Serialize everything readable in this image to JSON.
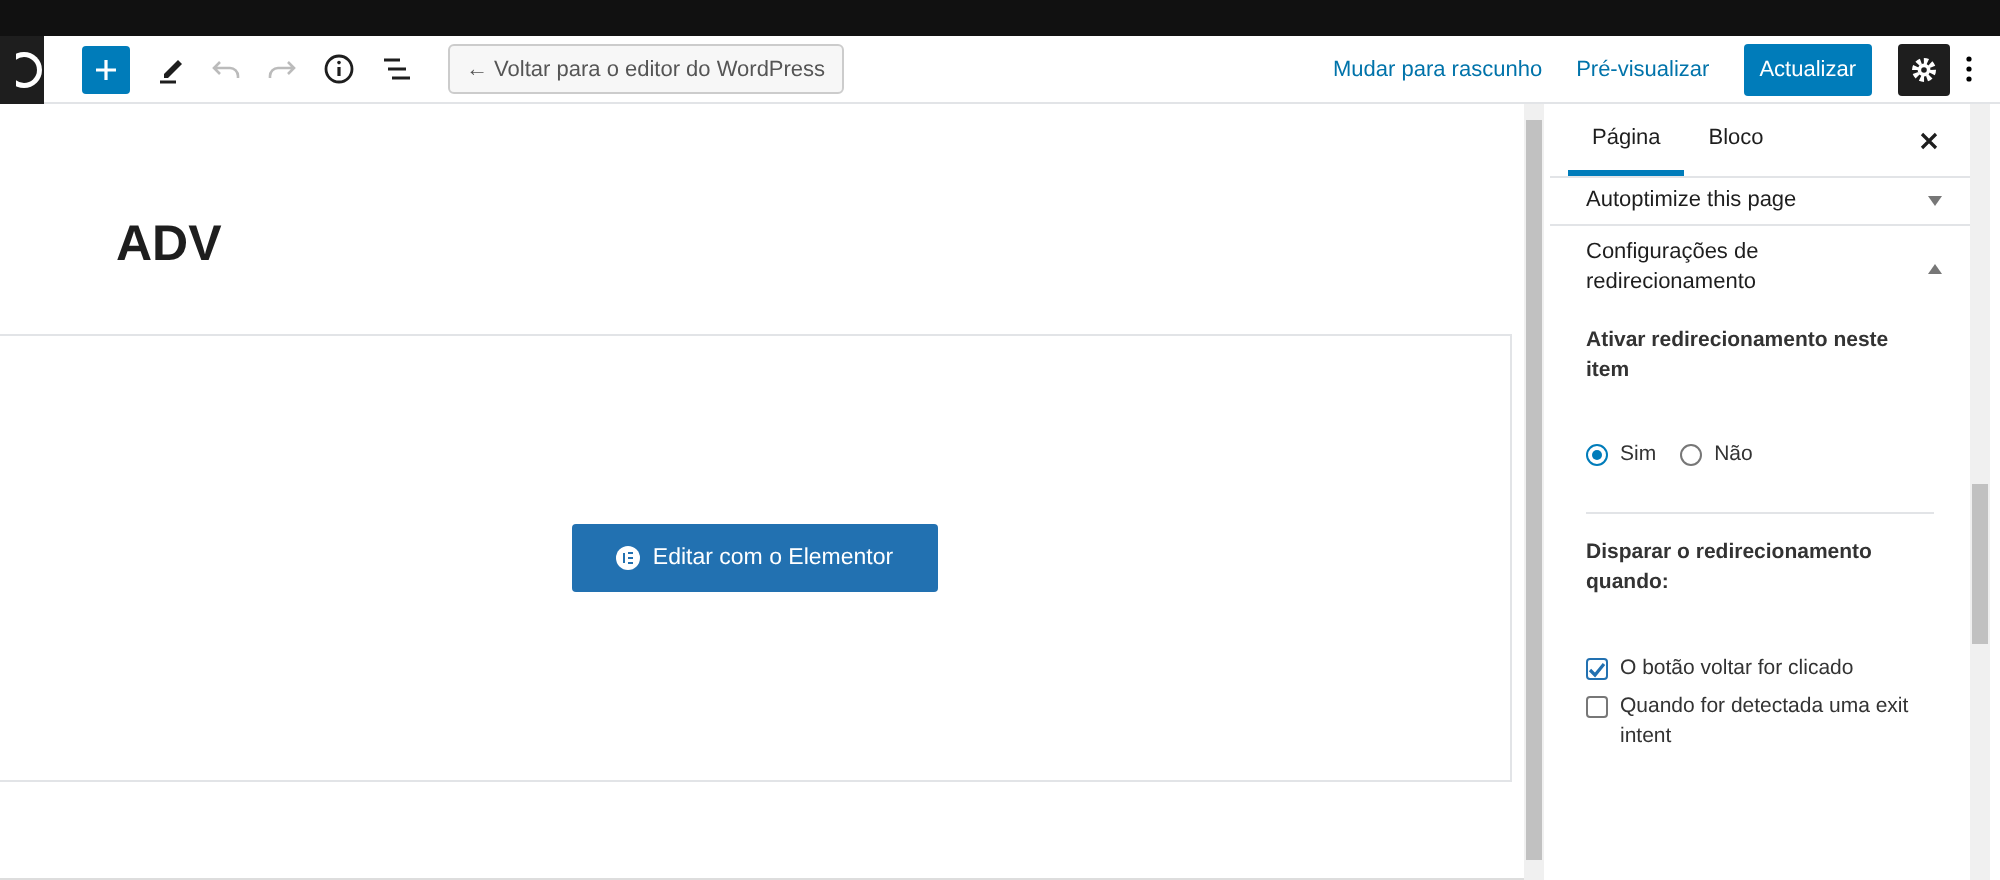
{
  "toolbar": {
    "back_button": "← Voltar para o editor do WordPress",
    "switch_to_draft": "Mudar para rascunho",
    "preview": "Pré-visualizar",
    "update_button": "Actualizar",
    "settings_active": true
  },
  "editor": {
    "title": "ADV",
    "elementor_button": "Editar com o Elementor"
  },
  "sidebar": {
    "tabs": [
      {
        "label": "Página",
        "selected": true
      },
      {
        "label": "Bloco",
        "selected": false
      }
    ],
    "panels": [
      {
        "title": "Autoptimize this page",
        "expanded": false
      },
      {
        "title": "Configurações de redirecionamento",
        "expanded": true
      }
    ],
    "enable_label": "Ativar redirecionamento neste item",
    "radios": [
      {
        "label": "Sim",
        "selected": true
      },
      {
        "label": "Não",
        "selected": false
      }
    ],
    "trigger_label": "Disparar o redirecionamento quando:",
    "checkboxes": [
      {
        "label": "O botão voltar for clicado",
        "checked": true
      },
      {
        "label": "Quando for detectada uma exit intent",
        "checked": false
      }
    ]
  }
}
